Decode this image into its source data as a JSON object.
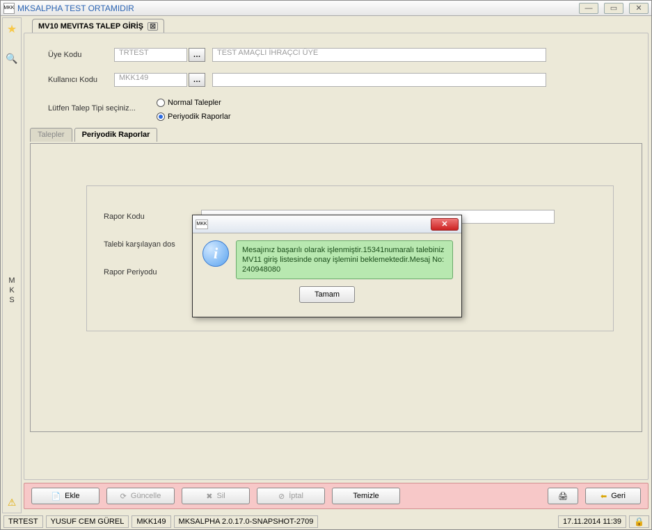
{
  "window": {
    "title": "MKSALPHA TEST ORTAMIDIR",
    "app_icon_text": "MKK"
  },
  "tab": {
    "title": "MV10 MEVITAS TALEP GİRİŞ"
  },
  "form": {
    "uye_kodu_label": "Üye Kodu",
    "uye_kodu_value": "TRTEST",
    "uye_kodu_desc": "TEST AMAÇLI İHRAÇCI ÜYE",
    "kullanici_kodu_label": "Kullanıcı Kodu",
    "kullanici_kodu_value": "MKK149",
    "talep_tipi_label": "Lütfen Talep Tipi seçiniz...",
    "normal_talepler": "Normal Talepler",
    "periyodik_raporlar": "Periyodik Raporlar"
  },
  "inner_tabs": {
    "talepler": "Talepler",
    "periyodik_raporlar": "Periyodik Raporlar"
  },
  "report_form": {
    "rapor_kodu_label": "Rapor Kodu",
    "talebi_label": "Talebi karşılayan dos",
    "rapor_periyodu_label": "Rapor Periyodu"
  },
  "toolbar": {
    "ekle": "Ekle",
    "guncelle": "Güncelle",
    "sil": "Sil",
    "iptal": "İptal",
    "temizle": "Temizle",
    "geri": "Geri"
  },
  "status": {
    "s1": "TRTEST",
    "s2": "YUSUF CEM GÜREL",
    "s3": "MKK149",
    "s4": "MKSALPHA 2.0.17.0-SNAPSHOT-2709",
    "datetime": "17.11.2014 11:39"
  },
  "dialog": {
    "icon_text": "MKK",
    "message": "Mesajınız başarılı olarak işlenmiştir.15341numaralı talebiniz MV11 giriş listesinde onay işlemini beklemektedir.Mesaj No: 240948080",
    "ok": "Tamam"
  },
  "side_label": {
    "m": "M",
    "k": "K",
    "s": "S"
  }
}
